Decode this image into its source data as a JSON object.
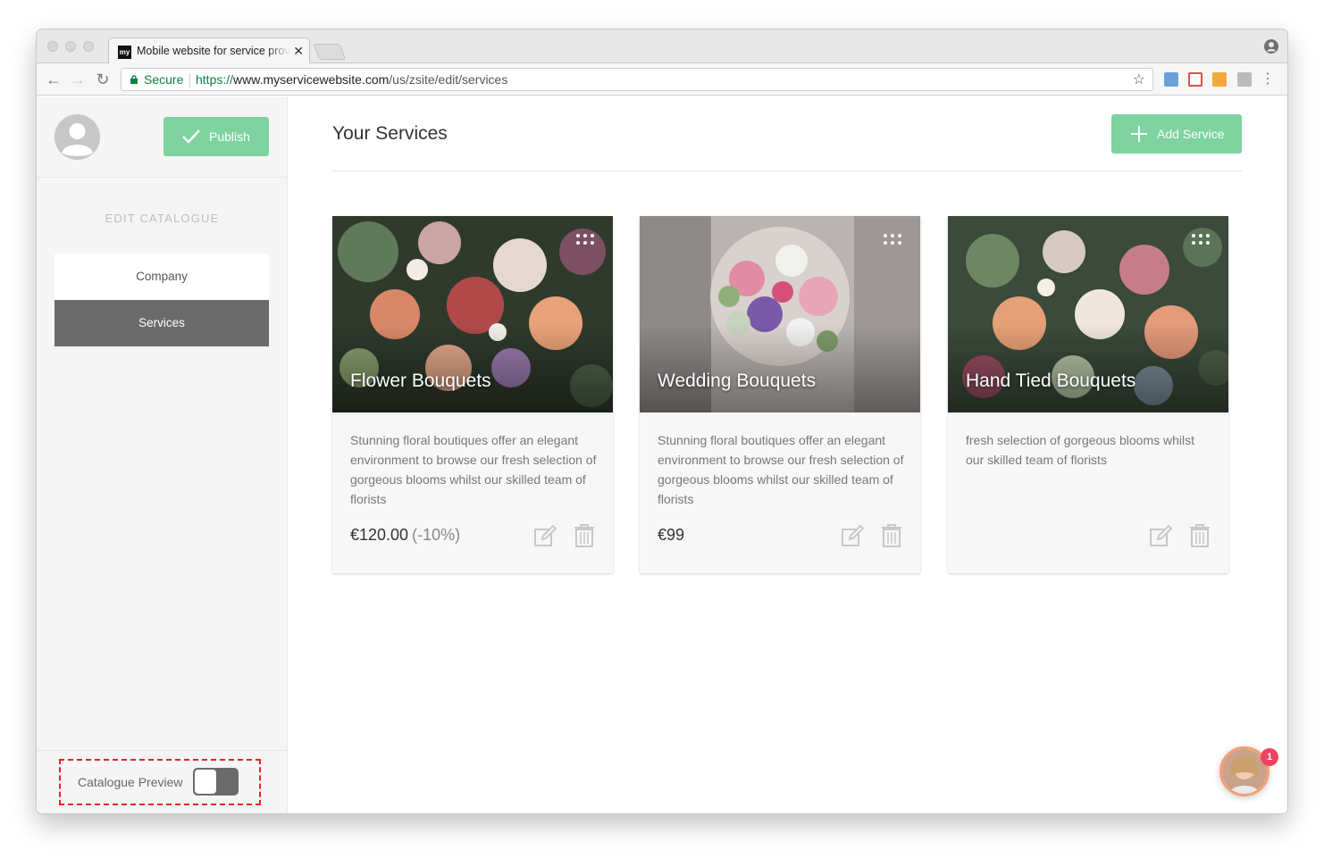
{
  "browser": {
    "tab_title": "Mobile website for service providers",
    "favicon_text": "my",
    "secure_label": "Secure",
    "url_scheme": "https://",
    "url_host": "www.myservicewebsite.com",
    "url_path": "/us/zsite/edit/services"
  },
  "sidebar": {
    "publish_label": "Publish",
    "section_title": "EDIT CATALOGUE",
    "nav_items": [
      {
        "label": "Company",
        "active": false
      },
      {
        "label": "Services",
        "active": true
      }
    ],
    "catalogue_preview_label": "Catalogue Preview",
    "catalogue_preview_on": false
  },
  "main": {
    "title": "Your Services",
    "add_service_label": "Add Service",
    "services": [
      {
        "title": "Flower Bouquets",
        "description": "Stunning floral boutiques offer an elegant environment to browse our fresh selection of gorgeous blooms whilst our skilled team of florists",
        "price": "€120.00",
        "discount": "(-10%)"
      },
      {
        "title": "Wedding Bouquets",
        "description": "Stunning floral boutiques offer an elegant environment to browse our fresh selection of gorgeous blooms whilst our skilled team of florists",
        "price": "€99",
        "discount": ""
      },
      {
        "title": "Hand Tied Bouquets",
        "description": "fresh selection of gorgeous blooms whilst our skilled team of florists",
        "price": "",
        "discount": ""
      }
    ]
  },
  "chat": {
    "badge_count": "1"
  },
  "colors": {
    "accent_green": "#7ed3a0",
    "active_nav": "#6b6b6b",
    "highlight_dashed": "#e8202a",
    "badge": "#f0435d"
  }
}
